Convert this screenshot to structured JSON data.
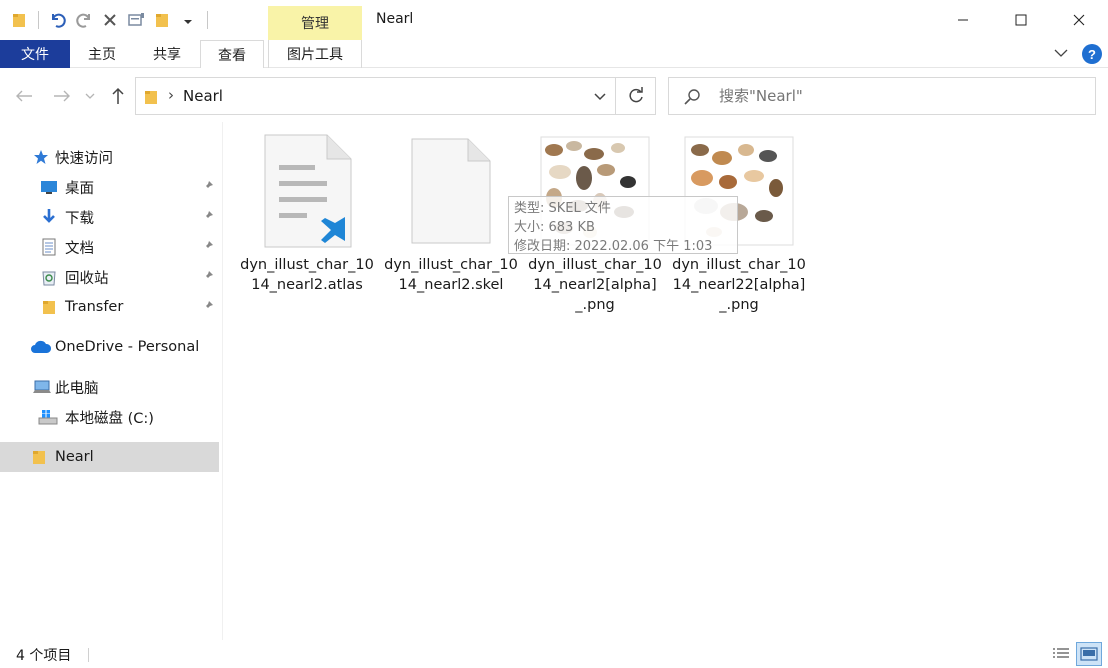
{
  "window": {
    "title": "Nearl",
    "context_tab_header": "管理",
    "controls": {
      "minimize": "minimize",
      "maximize": "maximize",
      "close": "close"
    }
  },
  "ribbon": {
    "tabs": [
      {
        "label": "文件"
      },
      {
        "label": "主页"
      },
      {
        "label": "共享"
      },
      {
        "label": "查看"
      },
      {
        "label": "图片工具"
      }
    ],
    "help_label": "?"
  },
  "address": {
    "path": "Nearl",
    "chevron": "›"
  },
  "search": {
    "placeholder": "搜索\"Nearl\""
  },
  "sidebar": {
    "items": [
      {
        "label": "快速访问",
        "icon": "star-icon"
      },
      {
        "label": "桌面",
        "icon": "desktop-icon",
        "pinned": true
      },
      {
        "label": "下载",
        "icon": "download-icon",
        "pinned": true
      },
      {
        "label": "文档",
        "icon": "document-icon",
        "pinned": true
      },
      {
        "label": "回收站",
        "icon": "recycle-bin-icon",
        "pinned": true
      },
      {
        "label": "Transfer",
        "icon": "folder-icon",
        "pinned": true
      },
      {
        "label": "OneDrive - Personal",
        "icon": "cloud-icon"
      },
      {
        "label": "此电脑",
        "icon": "computer-icon"
      },
      {
        "label": "本地磁盘 (C:)",
        "icon": "drive-icon"
      },
      {
        "label": "Nearl",
        "icon": "folder-icon",
        "selected": true
      }
    ]
  },
  "files": [
    {
      "name": "dyn_illust_char_1014_nearl2.atlas",
      "icon": "vscode-file-icon"
    },
    {
      "name": "dyn_illust_char_1014_nearl2.skel",
      "icon": "blank-file-icon"
    },
    {
      "name": "dyn_illust_char_1014_nearl2[alpha]_.png",
      "icon": "image-thumbnail"
    },
    {
      "name": "dyn_illust_char_1014_nearl22[alpha]_.png",
      "icon": "image-thumbnail"
    }
  ],
  "tooltip": {
    "type_line": "类型: SKEL 文件",
    "size_line": "大小: 683 KB",
    "modified_line": "修改日期: 2022.02.06 下午 1:03"
  },
  "status": {
    "count": "4 个项目"
  },
  "colors": {
    "file_tab": "#1c3d9b",
    "context_header": "#f9f3a8",
    "selected_bg": "#d9d9d9",
    "help": "#1f6fd1",
    "folder": "#f2c14e"
  }
}
